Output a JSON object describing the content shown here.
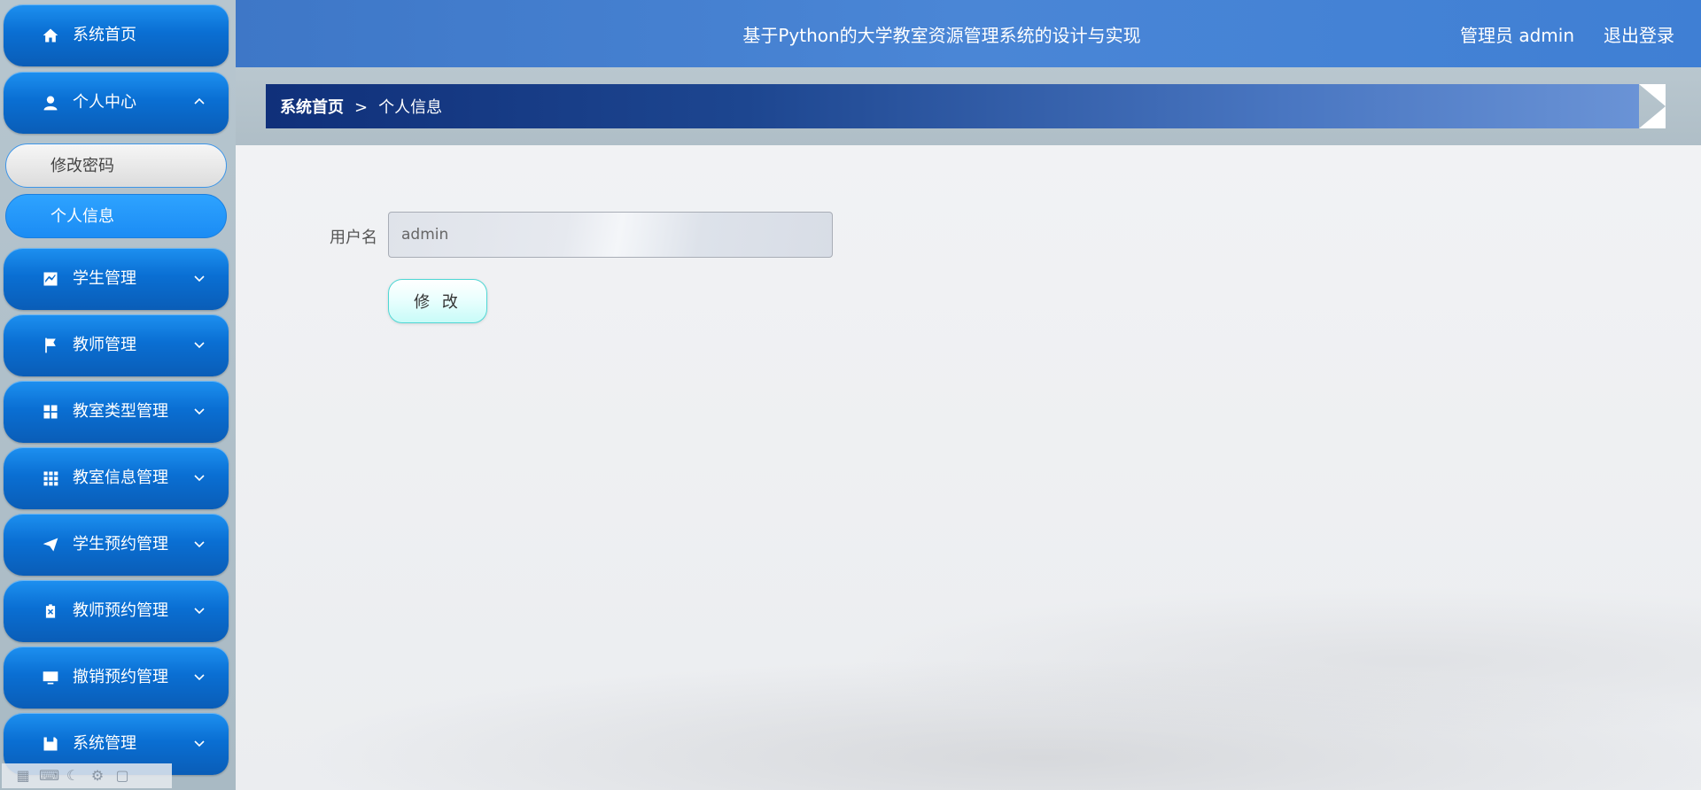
{
  "header": {
    "title": "基于Python的大学教室资源管理系统的设计与实现",
    "user": "管理员 admin",
    "logout": "退出登录"
  },
  "sidebar": {
    "items": [
      {
        "label": "系统首页",
        "icon": "home-icon"
      },
      {
        "label": "个人中心",
        "icon": "user-icon",
        "expanded": true,
        "children": [
          {
            "label": "修改密码",
            "active": false
          },
          {
            "label": "个人信息",
            "active": true
          }
        ]
      },
      {
        "label": "学生管理",
        "icon": "chart-icon"
      },
      {
        "label": "教师管理",
        "icon": "flag-icon"
      },
      {
        "label": "教室类型管理",
        "icon": "grid-icon"
      },
      {
        "label": "教室信息管理",
        "icon": "apps-icon"
      },
      {
        "label": "学生预约管理",
        "icon": "send-icon"
      },
      {
        "label": "教师预约管理",
        "icon": "clipboard-icon"
      },
      {
        "label": "撤销预约管理",
        "icon": "monitor-icon"
      },
      {
        "label": "系统管理",
        "icon": "save-icon"
      }
    ]
  },
  "breadcrumb": {
    "home": "系统首页",
    "separator": ">",
    "current": "个人信息"
  },
  "form": {
    "username_label": "用户名",
    "username_value": "admin",
    "submit_label": "修 改"
  },
  "colors": {
    "nav_blue": "#0a6fd3",
    "header_blue": "#4a86d6",
    "breadcrumb_dark": "#10307a",
    "button_border": "#4fd7d4"
  }
}
